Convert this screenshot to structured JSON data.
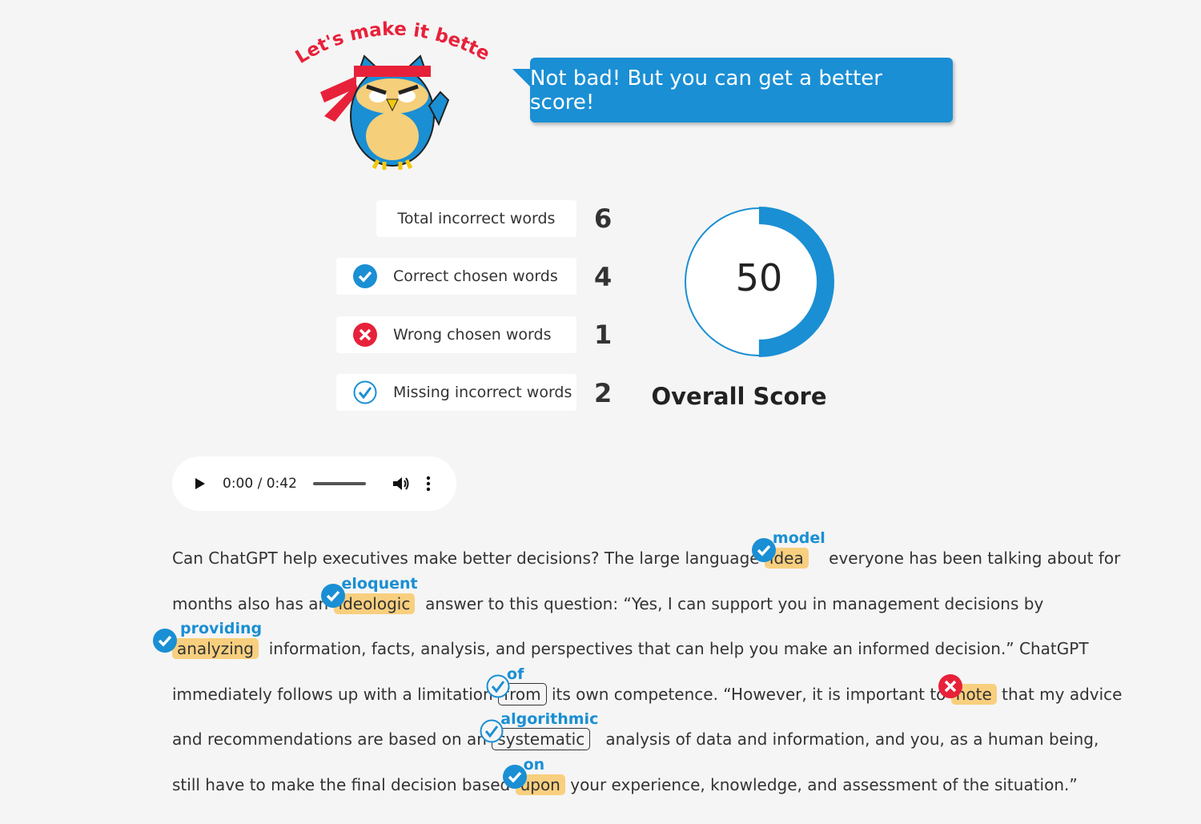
{
  "mascot": {
    "caption": "Let's make it better!",
    "icon": "owl-mascot"
  },
  "bubble": {
    "text": "Not bad! But you can get a better score!"
  },
  "stats": [
    {
      "label": "Total incorrect words",
      "value": "6",
      "icon": ""
    },
    {
      "label": "Correct chosen words",
      "value": "4",
      "icon": "check-filled-icon"
    },
    {
      "label": "Wrong chosen words",
      "value": "1",
      "icon": "x-red-icon"
    },
    {
      "label": "Missing incorrect words",
      "value": "2",
      "icon": "check-outline-icon"
    }
  ],
  "score": {
    "value": "50",
    "label": "Overall Score",
    "percent": 50
  },
  "player": {
    "time": "0:00 / 0:42",
    "progress": 0
  },
  "colors": {
    "accent": "#1a8fd4",
    "highlight": "#f8cf7e",
    "wrong": "#e8213a"
  },
  "lines": [
    [
      {
        "t": "Can ChatGPT help executives make better decisions? The large language "
      },
      {
        "w": "idea",
        "c": "model",
        "s": "correct"
      },
      {
        "t": "    everyone has been talking about for"
      }
    ],
    [
      {
        "t": "months also has an "
      },
      {
        "w": "ideologic",
        "c": "eloquent",
        "s": "correct"
      },
      {
        "t": "  answer to this question: “Yes, I can support you in management decisions by"
      }
    ],
    [
      {
        "w": "analyzing",
        "c": "providing",
        "s": "correct"
      },
      {
        "t": "  information, facts, analysis, and perspectives that can help you make an informed decision.” ChatGPT"
      }
    ],
    [
      {
        "t": "immediately follows up with a limitation "
      },
      {
        "w": "from",
        "c": "of",
        "s": "missing"
      },
      {
        "t": " its own competence. “However, it is important to "
      },
      {
        "w": "note",
        "c": "",
        "s": "wrong"
      },
      {
        "t": " that my advice"
      }
    ],
    [
      {
        "t": "and recommendations are based on an "
      },
      {
        "w": "systematic",
        "c": "algorithmic",
        "s": "missing"
      },
      {
        "t": "   analysis of data and information, and you, as a human being,"
      }
    ],
    [
      {
        "t": "still have to make the final decision based "
      },
      {
        "w": "upon",
        "c": "on",
        "s": "correct"
      },
      {
        "t": " your experience, knowledge, and assessment of the situation.”"
      }
    ]
  ]
}
